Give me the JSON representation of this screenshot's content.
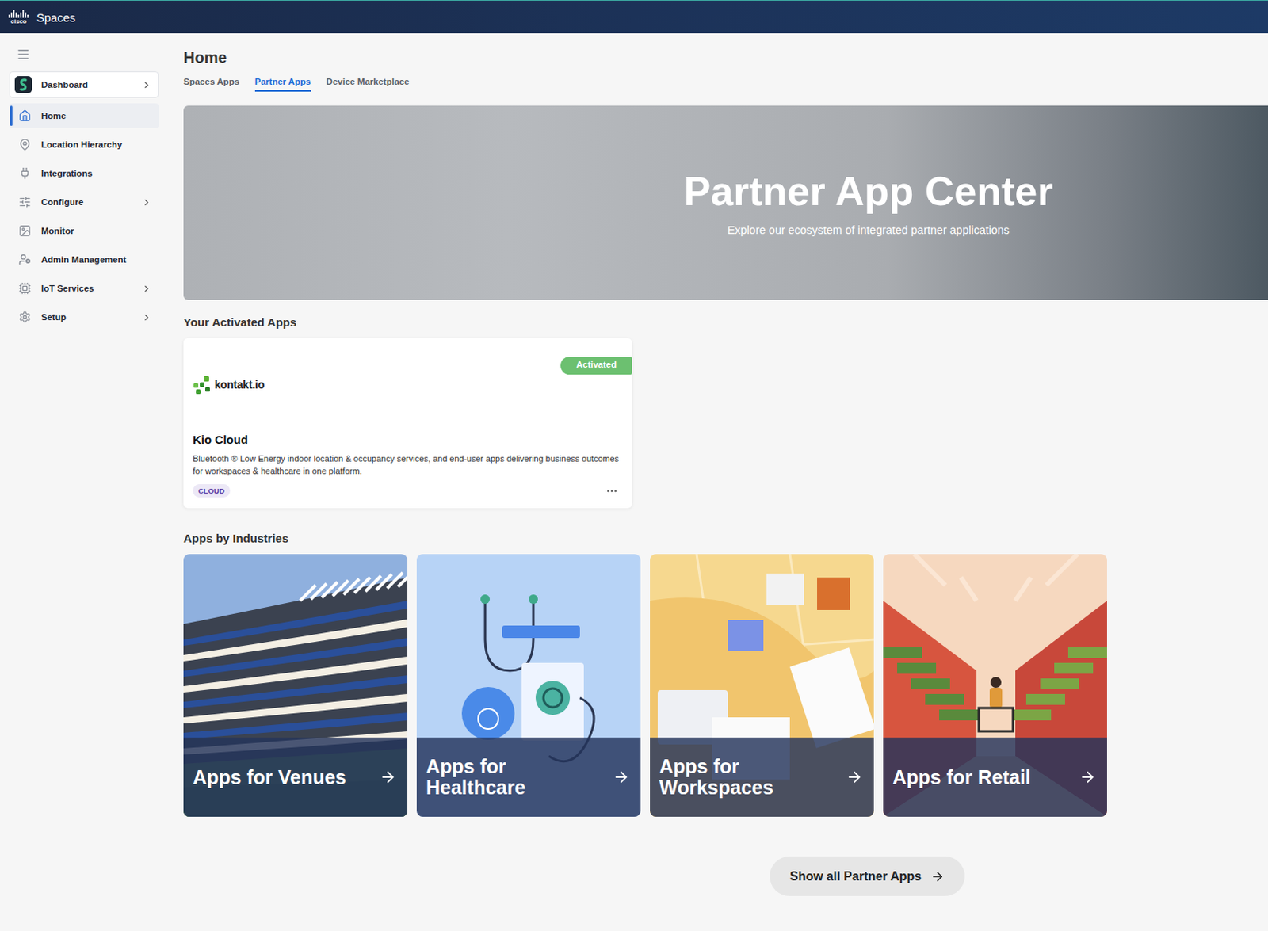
{
  "header": {
    "logo": "cisco",
    "brand": "Spaces"
  },
  "sidebar": {
    "items": [
      {
        "label": "Dashboard",
        "kind": "workspace",
        "selected": false,
        "has_submenu": true
      },
      {
        "label": "Home",
        "kind": "link",
        "selected": true,
        "has_submenu": false
      },
      {
        "label": "Location Hierarchy",
        "kind": "link",
        "selected": false,
        "has_submenu": false
      },
      {
        "label": "Integrations",
        "kind": "link",
        "selected": false,
        "has_submenu": false
      },
      {
        "label": "Configure",
        "kind": "link",
        "selected": false,
        "has_submenu": true
      },
      {
        "label": "Monitor",
        "kind": "link",
        "selected": false,
        "has_submenu": false
      },
      {
        "label": "Admin Management",
        "kind": "link",
        "selected": false,
        "has_submenu": false
      },
      {
        "label": "IoT Services",
        "kind": "link",
        "selected": false,
        "has_submenu": true
      },
      {
        "label": "Setup",
        "kind": "link",
        "selected": false,
        "has_submenu": true
      }
    ]
  },
  "page": {
    "title": "Home"
  },
  "tabs": [
    {
      "label": "Spaces Apps",
      "selected": false
    },
    {
      "label": "Partner Apps",
      "selected": true
    },
    {
      "label": "Device Marketplace",
      "selected": false
    }
  ],
  "hero": {
    "title": "Partner App Center",
    "subtitle": "Explore our ecosystem of integrated partner applications"
  },
  "activated": {
    "heading": "Your Activated Apps",
    "apps": [
      {
        "vendor": "kontakt.io",
        "name": "Kio Cloud",
        "status": "Activated",
        "tag": "CLOUD",
        "description": "Bluetooth ® Low Energy indoor location & occupancy services, and end-user apps delivering business outcomes for workspaces & healthcare in one platform."
      }
    ]
  },
  "industries": {
    "heading": "Apps by Industries",
    "items": [
      {
        "label": "Apps for Venues",
        "kind": "venues"
      },
      {
        "label": "Apps for Healthcare",
        "kind": "healthcare"
      },
      {
        "label": "Apps for Workspaces",
        "kind": "workspaces"
      },
      {
        "label": "Apps for Retail",
        "kind": "retail"
      }
    ]
  },
  "button": "Show all Partner Apps"
}
